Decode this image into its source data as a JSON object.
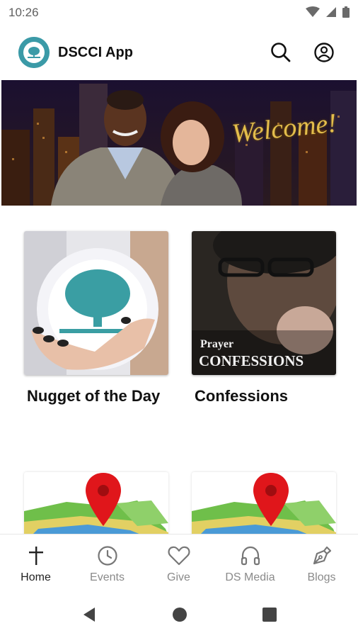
{
  "status": {
    "time": "10:26"
  },
  "appbar": {
    "title": "DSCCI App",
    "search_icon": "search-icon",
    "account_icon": "account-icon"
  },
  "banner": {
    "welcome_text": "Welcome!"
  },
  "cards": [
    {
      "title": "Nugget of the Day"
    },
    {
      "title": "Confessions",
      "image_overlay_line1": "Prayer",
      "image_overlay_line2": "CONFESSIONS"
    }
  ],
  "bottom_nav": [
    {
      "label": "Home",
      "icon": "cross-icon",
      "active": true
    },
    {
      "label": "Events",
      "icon": "clock-icon"
    },
    {
      "label": "Give",
      "icon": "heart-icon"
    },
    {
      "label": "DS Media",
      "icon": "headphones-icon"
    },
    {
      "label": "Blogs",
      "icon": "pen-nib-icon"
    }
  ],
  "colors": {
    "accent": "#3b9aa7",
    "pin": "#e0161b",
    "welcome_gold": "#e3bd4c"
  }
}
